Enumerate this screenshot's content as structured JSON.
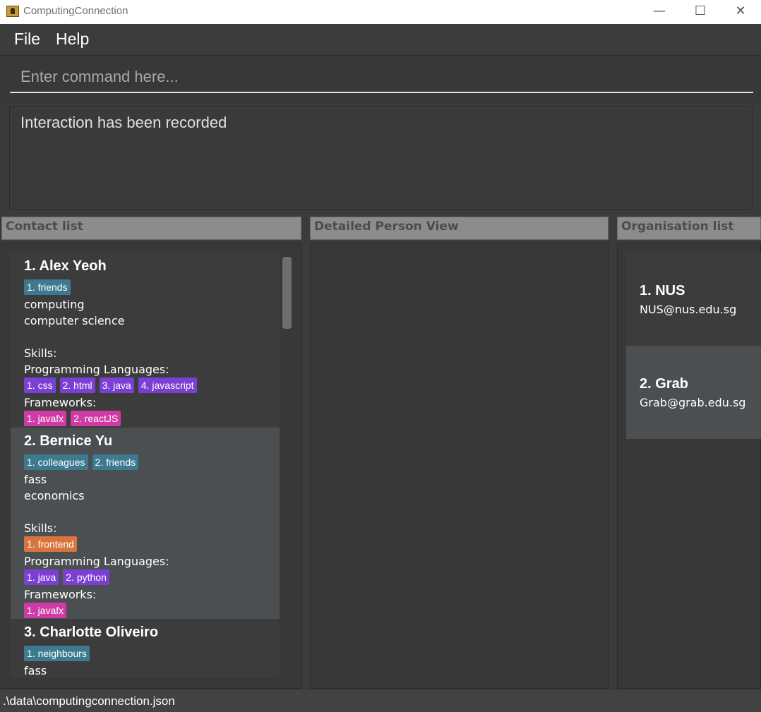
{
  "window": {
    "title": "ComputingConnection",
    "minimize": "—",
    "maximize": "☐",
    "close": "✕"
  },
  "menu": {
    "file": "File",
    "help": "Help"
  },
  "command": {
    "placeholder": "Enter command here..."
  },
  "result": {
    "text": "Interaction has been recorded"
  },
  "panels": {
    "contacts_title": "Contact list",
    "detail_title": "Detailed Person View",
    "orgs_title": "Organisation list"
  },
  "persons": [
    {
      "name": "1.  Alex Yeoh",
      "tags": [
        "1. friends"
      ],
      "faculty": "computing",
      "major": "computer science",
      "skills_label": "Skills:",
      "skills": [],
      "languages_label": "Programming Languages:",
      "languages": [
        "1. css",
        "2. html",
        "3. java",
        "4. javascript"
      ],
      "frameworks_label": "Frameworks:",
      "frameworks": [
        "1. javafx",
        "2. reactJS"
      ]
    },
    {
      "name": "2.  Bernice Yu",
      "tags": [
        "1. colleagues",
        "2. friends"
      ],
      "faculty": "fass",
      "major": "economics",
      "skills_label": "Skills:",
      "skills": [
        "1. frontend"
      ],
      "languages_label": "Programming Languages:",
      "languages": [
        "1. java",
        "2. python"
      ],
      "frameworks_label": "Frameworks:",
      "frameworks": [
        "1. javafx"
      ]
    },
    {
      "name": "3.  Charlotte Oliveiro",
      "tags": [
        "1. neighbours"
      ],
      "faculty": "fass"
    }
  ],
  "organisations": [
    {
      "name": "1.  NUS",
      "email": "NUS@nus.edu.sg"
    },
    {
      "name": "2.  Grab",
      "email": "Grab@grab.edu.sg"
    }
  ],
  "status": {
    "path": ".\\data\\computingconnection.json"
  },
  "colors": {
    "tag": "#3d7a8f",
    "language": "#7c3fd4",
    "framework": "#d03aa5",
    "skill": "#d9743a"
  }
}
